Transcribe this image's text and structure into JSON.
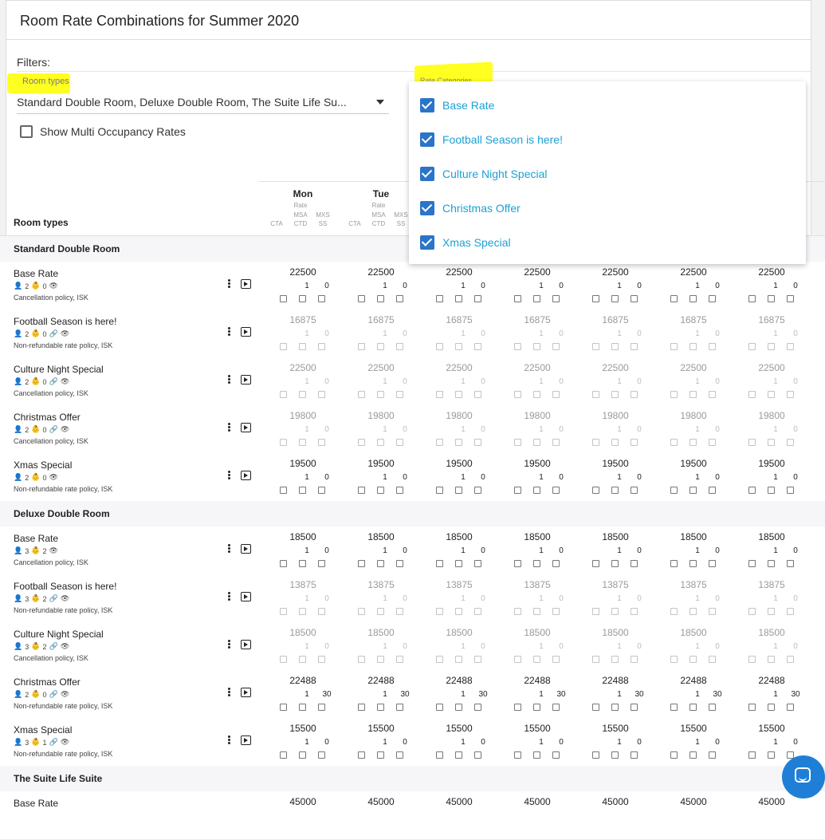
{
  "page": {
    "title": "Room Rate Combinations for Summer 2020"
  },
  "filters": {
    "label": "Filters:",
    "room_types_label": "Room types",
    "room_types_value": "Standard Double Room, Deluxe Double Room, The Suite Life Su...",
    "rate_categories_label": "Rate Categories",
    "multi_occupancy_label": "Show Multi Occupancy Rates",
    "rate_category_options": [
      "Base Rate",
      "Football Season is here!",
      "Culture Night Special",
      "Christmas Offer",
      "Xmas Special"
    ]
  },
  "colors": {
    "highlight": "#ffff22",
    "checkbox_blue": "#2b74c9",
    "link_blue": "#1da1d4",
    "chat_blue": "#1f7fd6"
  },
  "table": {
    "room_types_header": "Room types",
    "sub_headers": {
      "cta": "CTA",
      "rate": "Rate",
      "msa": "MSA",
      "ctd": "CTD",
      "mxs": "MXS",
      "ss": "SS"
    },
    "days": [
      "Mon",
      "Tue"
    ],
    "groups": [
      {
        "name": "Standard Double Room",
        "rates": [
          {
            "name": "Base Rate",
            "adults": "2",
            "children": "0",
            "policy": "Cancellation policy,  ISK",
            "price": "22500",
            "msa": "1",
            "mxs": "0",
            "dim": false,
            "linked": false
          },
          {
            "name": "Football Season is here!",
            "adults": "2",
            "children": "0",
            "policy": "Non-refundable rate policy,  ISK",
            "price": "16875",
            "msa": "1",
            "mxs": "0",
            "dim": true,
            "linked": true
          },
          {
            "name": "Culture Night Special",
            "adults": "2",
            "children": "0",
            "policy": "Cancellation policy,  ISK",
            "price": "22500",
            "msa": "1",
            "mxs": "0",
            "dim": true,
            "linked": true
          },
          {
            "name": "Christmas Offer",
            "adults": "2",
            "children": "0",
            "policy": "Cancellation policy,  ISK",
            "price": "19800",
            "msa": "1",
            "mxs": "0",
            "dim": true,
            "linked": true
          },
          {
            "name": "Xmas Special",
            "adults": "2",
            "children": "0",
            "policy": "Non-refundable rate policy,  ISK",
            "price": "19500",
            "msa": "1",
            "mxs": "0",
            "dim": false,
            "linked": false
          }
        ]
      },
      {
        "name": "Deluxe Double Room",
        "rates": [
          {
            "name": "Base Rate",
            "adults": "3",
            "children": "2",
            "policy": "Cancellation policy,  ISK",
            "price": "18500",
            "msa": "1",
            "mxs": "0",
            "dim": false,
            "linked": false
          },
          {
            "name": "Football Season is here!",
            "adults": "3",
            "children": "2",
            "policy": "Non-refundable rate policy,  ISK",
            "price": "13875",
            "msa": "1",
            "mxs": "0",
            "dim": true,
            "linked": true
          },
          {
            "name": "Culture Night Special",
            "adults": "3",
            "children": "2",
            "policy": "Cancellation policy,  ISK",
            "price": "18500",
            "msa": "1",
            "mxs": "0",
            "dim": true,
            "linked": true
          },
          {
            "name": "Christmas Offer",
            "adults": "2",
            "children": "0",
            "policy": "Non-refundable rate policy,  ISK",
            "price": "22488",
            "msa": "1",
            "mxs": "30",
            "dim": false,
            "linked": true
          },
          {
            "name": "Xmas Special",
            "adults": "3",
            "children": "1",
            "policy": "Non-refundable rate policy,  ISK",
            "price": "15500",
            "msa": "1",
            "mxs": "0",
            "dim": false,
            "linked": true
          }
        ]
      },
      {
        "name": "The Suite Life Suite",
        "rates": [
          {
            "name": "Base Rate",
            "adults": "",
            "children": "",
            "policy": "",
            "price": "45000",
            "msa": "",
            "mxs": "",
            "dim": false,
            "linked": false
          }
        ]
      }
    ]
  }
}
